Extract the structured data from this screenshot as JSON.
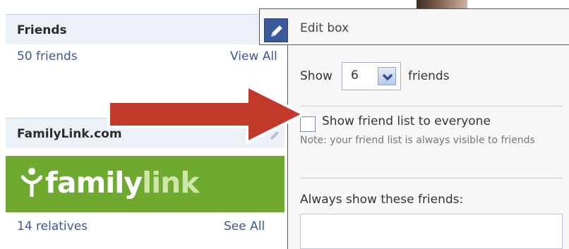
{
  "friends_box": {
    "title": "Friends",
    "count_text": "50 friends",
    "view_all_label": "View All"
  },
  "familylink_box": {
    "title": "FamilyLink.com",
    "logo_part1": "family",
    "logo_part2": "link",
    "relatives_text": "14 relatives",
    "see_all_label": "See All"
  },
  "edit_box": {
    "title": "Edit box",
    "show_label": "Show",
    "show_count": "6",
    "friends_label": "friends",
    "show_list_label": "Show friend list to everyone",
    "show_list_checked": false,
    "note": "Note: your friend list is always visible to friends",
    "always_show_label": "Always show these friends:",
    "always_show_value": ""
  },
  "colors": {
    "link": "#3b5998",
    "header_bg": "#ecf0f7",
    "banner": "#6daa2f",
    "arrow": "#c0392b",
    "edit_button": "#3b5998"
  },
  "icons": {
    "edit_button": "pencil-icon",
    "box_edit": "pencil-icon",
    "select_arrow": "chevron-down-icon",
    "annotation": "arrow-right-icon"
  }
}
